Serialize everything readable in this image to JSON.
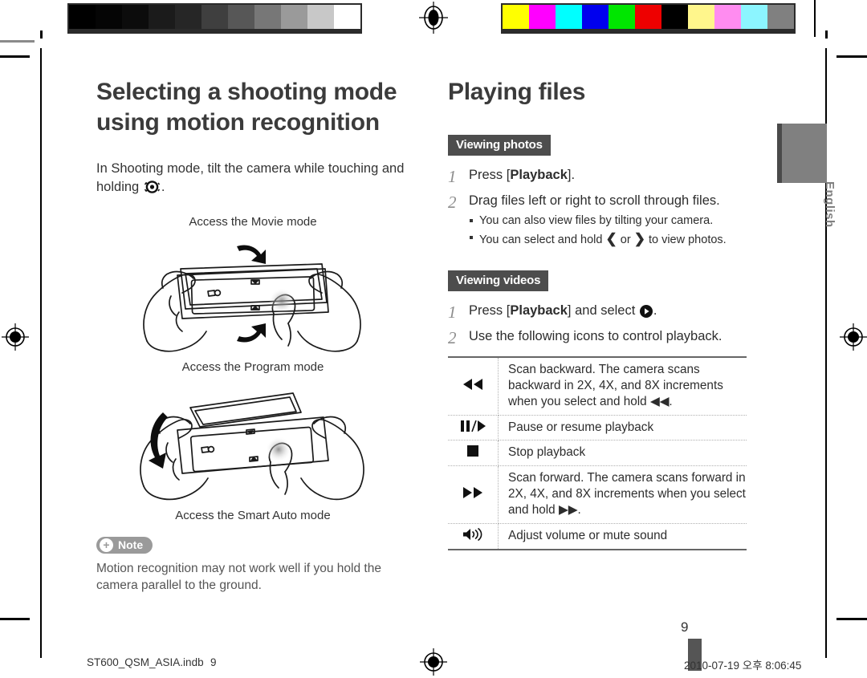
{
  "calibration": {
    "gray_patches": [
      "#000000",
      "#050505",
      "#0c0c0c",
      "#1b1b1b",
      "#262626",
      "#3f3f3f",
      "#575757",
      "#777777",
      "#9a9a9a",
      "#c8c8c8",
      "#ffffff"
    ],
    "color_patches": [
      "#ffff00",
      "#ff00ff",
      "#00ffff",
      "#0000ee",
      "#00e600",
      "#ee0000",
      "#000000",
      "#fff68c",
      "#ff8cf0",
      "#8cf5ff",
      "#808080"
    ],
    "registration_icon": "registration-target-icon"
  },
  "left_column": {
    "title": "Selecting a shooting mode using motion recognition",
    "intro_before_icon": "In Shooting mode, tilt the camera while touching and holding",
    "intro_after_icon": ".",
    "touch_icon": "touch-and-hold-icon",
    "figure_one": {
      "caption_top": "Access the Movie mode",
      "caption_bottom": "Access the Program mode",
      "illustration": "hands-holding-camera-tilt-icon"
    },
    "figure_two": {
      "caption_top": "Access the Program mode",
      "caption_bottom": "Access the Smart Auto mode",
      "illustration": "hands-holding-camera-tilt-down-icon"
    },
    "note": {
      "badge_label": "Note",
      "badge_icon": "plus-circle-icon",
      "text": "Motion recognition may not work well if you hold the camera parallel to the ground."
    }
  },
  "right_column": {
    "title": "Playing files",
    "viewing_photos": {
      "chip": "Viewing photos",
      "steps": [
        {
          "num": "1",
          "text_parts": [
            "Press [",
            "Playback",
            "]."
          ],
          "bullets": []
        },
        {
          "num": "2",
          "text_parts": [
            "Drag files left or right to scroll through files."
          ],
          "bullets": [
            "You can also view files by tilting your camera.",
            "You can select and hold ‹ or › to view photos."
          ]
        }
      ]
    },
    "viewing_videos": {
      "chip": "Viewing videos",
      "steps": [
        {
          "num": "1",
          "text_before": "Press [",
          "bold": "Playback",
          "text_after": "] and select",
          "icon": "play-circle-icon",
          "trailing": "."
        },
        {
          "num": "2",
          "text": "Use the following icons to control playback."
        }
      ],
      "table": {
        "rows": [
          {
            "icon": "rewind-icon",
            "glyph": "◀◀",
            "description": "Scan backward. The camera scans backward in 2X, 4X, and 8X increments when you select and hold ◀◀."
          },
          {
            "icon": "pause-play-icon",
            "glyph": "❙❙/▶",
            "description": "Pause or resume playback"
          },
          {
            "icon": "stop-icon",
            "glyph": "■",
            "description": "Stop playback"
          },
          {
            "icon": "fast-forward-icon",
            "glyph": "▶▶",
            "description": "Scan forward. The camera scans forward in 2X, 4X, and 8X increments when you select and hold ▶▶."
          },
          {
            "icon": "volume-icon",
            "glyph": "🔊",
            "description": "Adjust volume or mute sound"
          }
        ]
      }
    }
  },
  "language_tab": {
    "label": "English"
  },
  "page_number": "9",
  "footer": {
    "file_name": "ST600_QSM_ASIA.indb",
    "page": "9",
    "date_time": "2010-07-19   오후 8:06:45"
  },
  "colors": {
    "chip_bg": "#4d4d4d",
    "note_badge_bg": "#9a9a9a",
    "tab_bg": "#808080",
    "title_text": "#3b3b3b"
  }
}
